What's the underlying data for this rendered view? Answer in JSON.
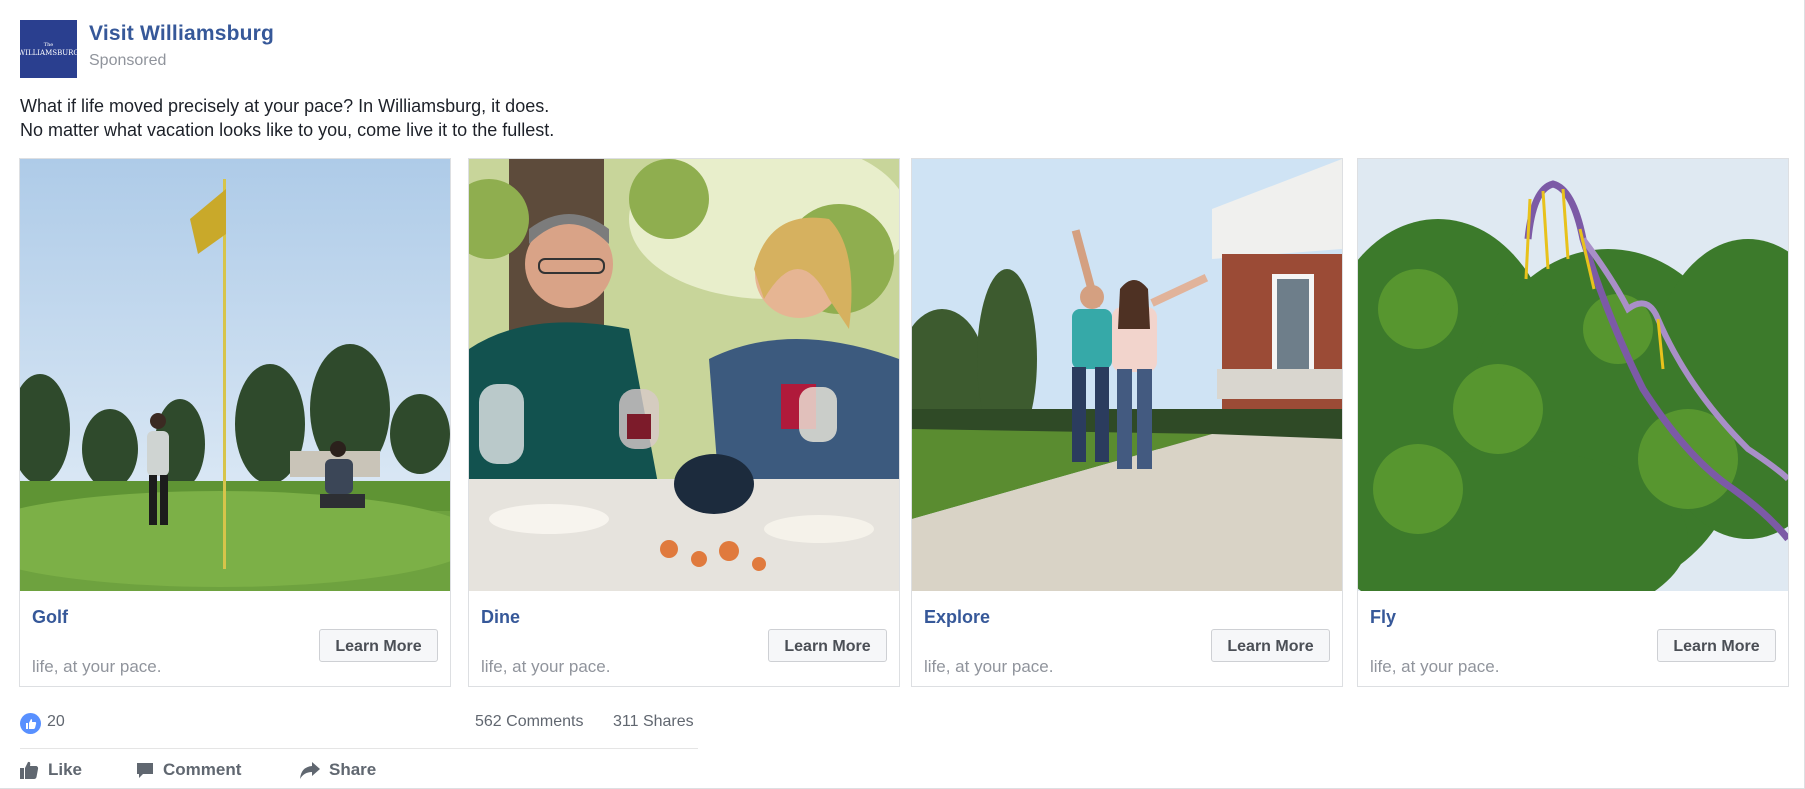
{
  "post": {
    "page_name": "Visit Williamsburg",
    "sponsored_label": "Sponsored",
    "logo_text_small": "The",
    "logo_text": "WILLIAMSBURG",
    "text_line1": "What if life moved precisely at your pace? In Williamsburg, it does.",
    "text_line2": "No matter what vacation looks like to you, come live it to the fullest."
  },
  "carousel": {
    "cards": [
      {
        "title": "Golf",
        "subtitle": "life, at your pace.",
        "button": "Learn More"
      },
      {
        "title": "Dine",
        "subtitle": "life, at your pace.",
        "button": "Learn More"
      },
      {
        "title": "Explore",
        "subtitle": "life, at your pace.",
        "button": "Learn More"
      },
      {
        "title": "Fly",
        "subtitle": "life, at your pace.",
        "button": "Learn More"
      }
    ]
  },
  "engagement": {
    "likes": "20",
    "comments": "562 Comments",
    "shares": "311 Shares"
  },
  "actions": {
    "like": "Like",
    "comment": "Comment",
    "share": "Share"
  },
  "colors": {
    "link_blue": "#365899",
    "meta_gray": "#90949c",
    "like_blue": "#5890ff"
  }
}
